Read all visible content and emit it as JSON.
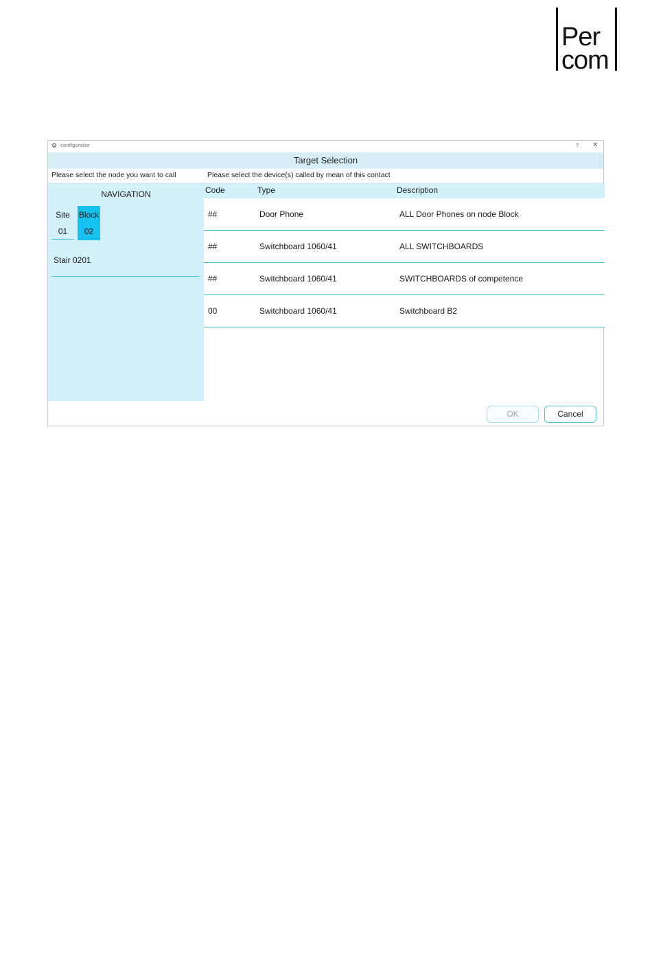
{
  "logo": {
    "line1": "Per",
    "line2": "com"
  },
  "window": {
    "app_title": "configurator",
    "help_label": "?",
    "close_label": "✕"
  },
  "dialog": {
    "title": "Target Selection",
    "left_hint": "Please select the node you want to call",
    "right_hint": "Please select the device(s) called by mean of this contact"
  },
  "navigation": {
    "title": "NAVIGATION",
    "breadcrumbs": [
      {
        "label": "Site",
        "value": "01"
      },
      {
        "label": "Block",
        "value": "02"
      }
    ],
    "items": [
      {
        "label": "Stair 0201"
      }
    ]
  },
  "table": {
    "headers": [
      "Code",
      "Type",
      "Description"
    ],
    "rows": [
      {
        "code": "##",
        "type": "Door Phone",
        "description": "ALL Door Phones on node Block"
      },
      {
        "code": "##",
        "type": "Switchboard 1060/41",
        "description": "ALL SWITCHBOARDS"
      },
      {
        "code": "##",
        "type": "Switchboard 1060/41",
        "description": "SWITCHBOARDS of competence"
      },
      {
        "code": "00",
        "type": "Switchboard 1060/41",
        "description": "Switchboard B2"
      }
    ]
  },
  "buttons": {
    "ok": "OK",
    "cancel": "Cancel"
  },
  "colors": {
    "header_bg": "#d6eef5",
    "panel_bg": "#d2f1fa",
    "accent": "#16c1ef",
    "row_divider": "#3fc0d6"
  }
}
